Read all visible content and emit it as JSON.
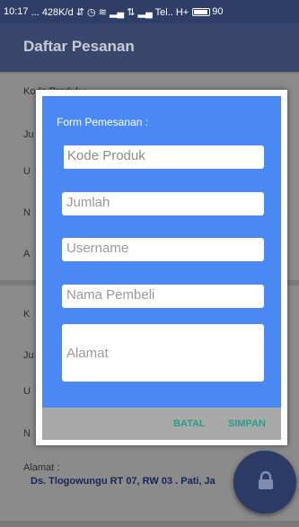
{
  "statusbar": {
    "time": "10:17",
    "text": "... 428K/d ⇵ ◷ ≋ ▂▄ ⇅ ▂▄ Tel.. H+",
    "battery": "90"
  },
  "appbar": {
    "title": "Daftar Pesanan"
  },
  "background_list": {
    "card1": {
      "label_kode": "Kode Produk :",
      "label_j": "Ju",
      "label_u": "U",
      "label_n": "N",
      "label_a": "A"
    },
    "card2": {
      "label_k": "K",
      "label_j": "Ju",
      "label_u": "U",
      "label_n": "N",
      "label_alamat": "Alamat :",
      "value_alamat": "Ds. Tlogowungu RT 07, RW 03 . Pati, Ja"
    }
  },
  "dialog": {
    "title": "Form Pemesanan :",
    "fields": {
      "kode_produk": "Kode Produk",
      "jumlah": "Jumlah",
      "username": "Username",
      "nama_pembeli": "Nama Pembeli",
      "alamat": "Alamat"
    },
    "buttons": {
      "cancel": "BATAL",
      "save": "SIMPAN"
    }
  },
  "fab": {
    "icon": "lock-icon"
  },
  "colors": {
    "primary": "#39476d",
    "dialog_blue": "#4a89f3",
    "accent": "#2a9d8f"
  }
}
